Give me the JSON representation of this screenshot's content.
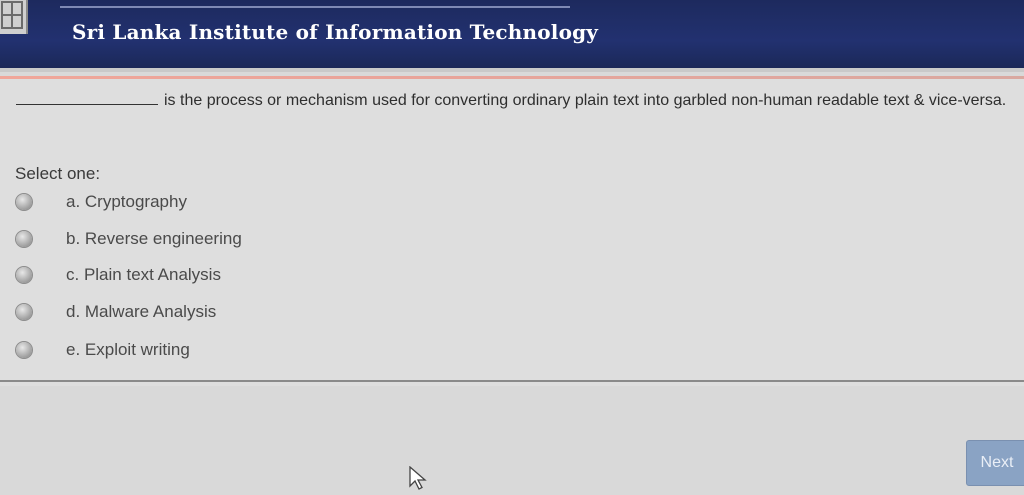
{
  "header": {
    "title": "Sri Lanka Institute of Information Technology"
  },
  "question": {
    "text": "is the process or mechanism used for converting ordinary plain text into garbled non-human readable text & vice-versa.",
    "select_label": "Select one:",
    "options": [
      {
        "label": "a. Cryptography"
      },
      {
        "label": "b. Reverse engineering"
      },
      {
        "label": "c. Plain text Analysis"
      },
      {
        "label": "d. Malware Analysis"
      },
      {
        "label": "e. Exploit writing"
      }
    ]
  },
  "navigation": {
    "next_label": "Next"
  },
  "icons": {
    "logo": "institute-logo-icon",
    "cursor": "mouse-cursor-icon"
  },
  "colors": {
    "header_bg": "#223170",
    "page_bg": "#d9d9d9",
    "next_button": "#8aa3c4"
  }
}
